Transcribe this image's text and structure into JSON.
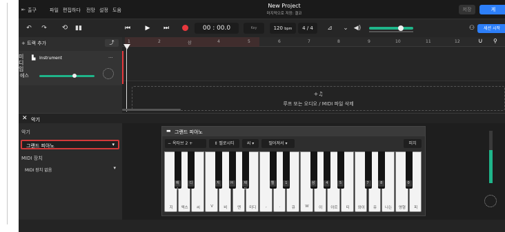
{
  "menubar": {
    "exit": "출구",
    "items": [
      "파일",
      "편집하다",
      "전망",
      "설정",
      "도움"
    ],
    "project_title": "New Project",
    "save_status": "마지막으로 저장: 결코",
    "save_label": "저장",
    "share_label": "게"
  },
  "toolbar": {
    "time": "00 : 00.0",
    "key": "Key",
    "bpm_value": "120",
    "bpm_unit": "bpm",
    "time_signature": "4 / 4",
    "session_label": "세션 시작"
  },
  "tracks": {
    "add_track": "트랙 추가",
    "midi_label": "미디",
    "midi_label2": "입",
    "instrument_name": "Instrument",
    "more": "...",
    "fx_label": "에스"
  },
  "ruler": {
    "numbers": [
      "1",
      "2",
      "삼",
      "4",
      "5",
      "6",
      "7",
      "8",
      "9",
      "10",
      "11",
      "12"
    ]
  },
  "dropzone": {
    "text": "루프 또는 오디오 / MIDI 파일 삭제"
  },
  "panel": {
    "close_label": "악기",
    "instrument_section": "악기",
    "instrument_selected": "그랜드 피아노",
    "midi_section": "MIDI 장치",
    "midi_selected": "MIDI 장치 없음"
  },
  "keyboard": {
    "title": "그랜드 피아노",
    "octave_label": "옥타브",
    "octave_value": "2",
    "velocity_label": "벨로시티",
    "velocity_short": "씨",
    "sustain_label": "떨어져서",
    "pitch_label": "피치",
    "black_labels": [
      "에스",
      "디",
      "지",
      "H",
      "제이",
      "엘",
      "1",
      "삼",
      "4",
      "5",
      "7",
      "8",
      "0"
    ],
    "white_labels": [
      "지",
      "엑스",
      "씨",
      "V",
      "비",
      "엔",
      "미디",
      ",",
      ".",
      "큐",
      "W",
      "이",
      "아르",
      "티",
      "와이",
      "유",
      "나는",
      "영형",
      "피"
    ]
  },
  "colors": {
    "accent": "#2d7ff9",
    "record": "#e8383d",
    "meter": "#1fb58a",
    "select_border": "#d33a3a"
  }
}
